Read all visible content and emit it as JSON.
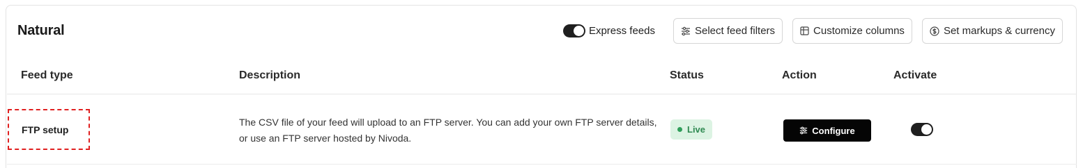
{
  "section": {
    "title": "Natural"
  },
  "toolbar": {
    "express_label": "Express feeds",
    "express_enabled": true,
    "filters_label": "Select feed filters",
    "columns_label": "Customize columns",
    "markups_label": "Set markups & currency"
  },
  "table": {
    "headers": {
      "feed_type": "Feed type",
      "description": "Description",
      "status": "Status",
      "action": "Action",
      "activate": "Activate"
    },
    "rows": [
      {
        "feed_type": "FTP setup",
        "description": "The CSV file of your feed will upload to an FTP server. You can add your own FTP server details, or use an FTP server hosted by Nivoda.",
        "status": "Live",
        "action": "Configure",
        "active": true
      }
    ]
  },
  "colors": {
    "status_live_bg": "#dcf3e3",
    "status_live_text": "#2f8a52",
    "primary_button": "#050505",
    "highlight_border": "#e02020"
  },
  "icons": {
    "filters": "sliders-icon",
    "columns": "table-columns-icon",
    "markups": "dollar-circle-icon",
    "configure": "sliders-icon"
  }
}
